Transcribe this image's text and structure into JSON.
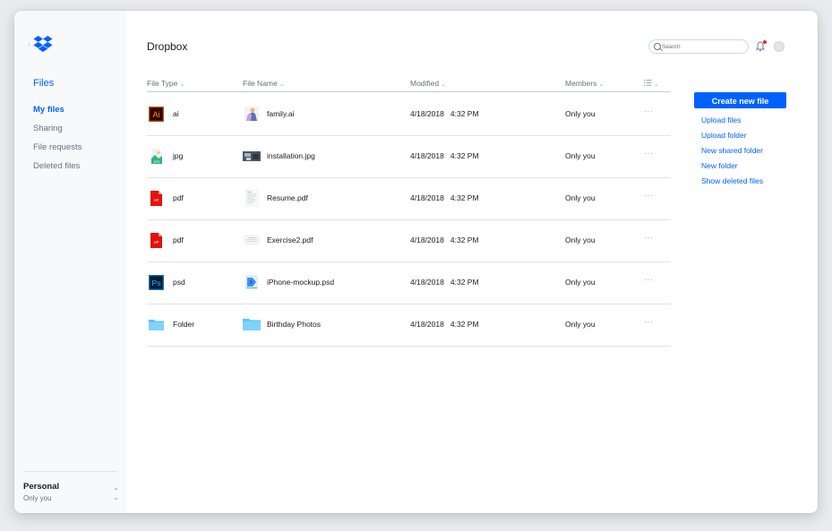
{
  "app": {
    "title": "Dropbox"
  },
  "sidebar": {
    "section_title": "Files",
    "items": [
      {
        "label": "My files",
        "active": true
      },
      {
        "label": "Sharing"
      },
      {
        "label": "File requests"
      },
      {
        "label": "Deleted files"
      }
    ],
    "account": {
      "name": "Personal",
      "subtitle": "Only you"
    }
  },
  "header": {
    "search_placeholder": "Search",
    "notification_badge_color": "#e02a2a"
  },
  "table": {
    "columns": {
      "type": "File Type",
      "name": "File Name",
      "modified": "Modified",
      "members": "Members"
    },
    "rows": [
      {
        "type": "ai",
        "type_icon": "illustrator-icon",
        "name": "family.ai",
        "modified": "4/18/2018   4:32 PM",
        "members": "Only you",
        "more": "···"
      },
      {
        "type": "jpg",
        "type_icon": "jpg-icon",
        "name": "installation.jpg",
        "modified": "4/18/2018   4:32 PM",
        "members": "Only you",
        "more": "···"
      },
      {
        "type": "pdf",
        "type_icon": "pdf-icon",
        "name": "Resume.pdf",
        "modified": "4/18/2018   4:32 PM",
        "members": "Only you",
        "more": "···"
      },
      {
        "type": "pdf",
        "type_icon": "pdf-icon",
        "name": "Exercise2.pdf",
        "modified": "4/18/2018   4:32 PM",
        "members": "Only you",
        "more": "···"
      },
      {
        "type": "psd",
        "type_icon": "photoshop-icon",
        "name": "iPhone-mockup.psd",
        "modified": "4/18/2018   4:32 PM",
        "members": "Only you",
        "more": "···"
      },
      {
        "type": "Folder",
        "type_icon": "folder-icon",
        "name": "Birthday Photos",
        "modified": "4/18/2018   4:32 PM",
        "members": "Only you",
        "more": "···"
      }
    ]
  },
  "actions": {
    "primary": "Create new file",
    "links": [
      "Upload files",
      "Upload folder",
      "New shared folder",
      "New folder",
      "Show deleted files"
    ]
  },
  "colors": {
    "accent": "#0061fe",
    "adobe_ai_bg": "#330000",
    "adobe_ai_fg": "#ff9a00",
    "adobe_ps_bg": "#001e36",
    "adobe_ps_fg": "#31a8ff",
    "pdf_red": "#e3120b",
    "folder_blue": "#5cc5f7"
  }
}
